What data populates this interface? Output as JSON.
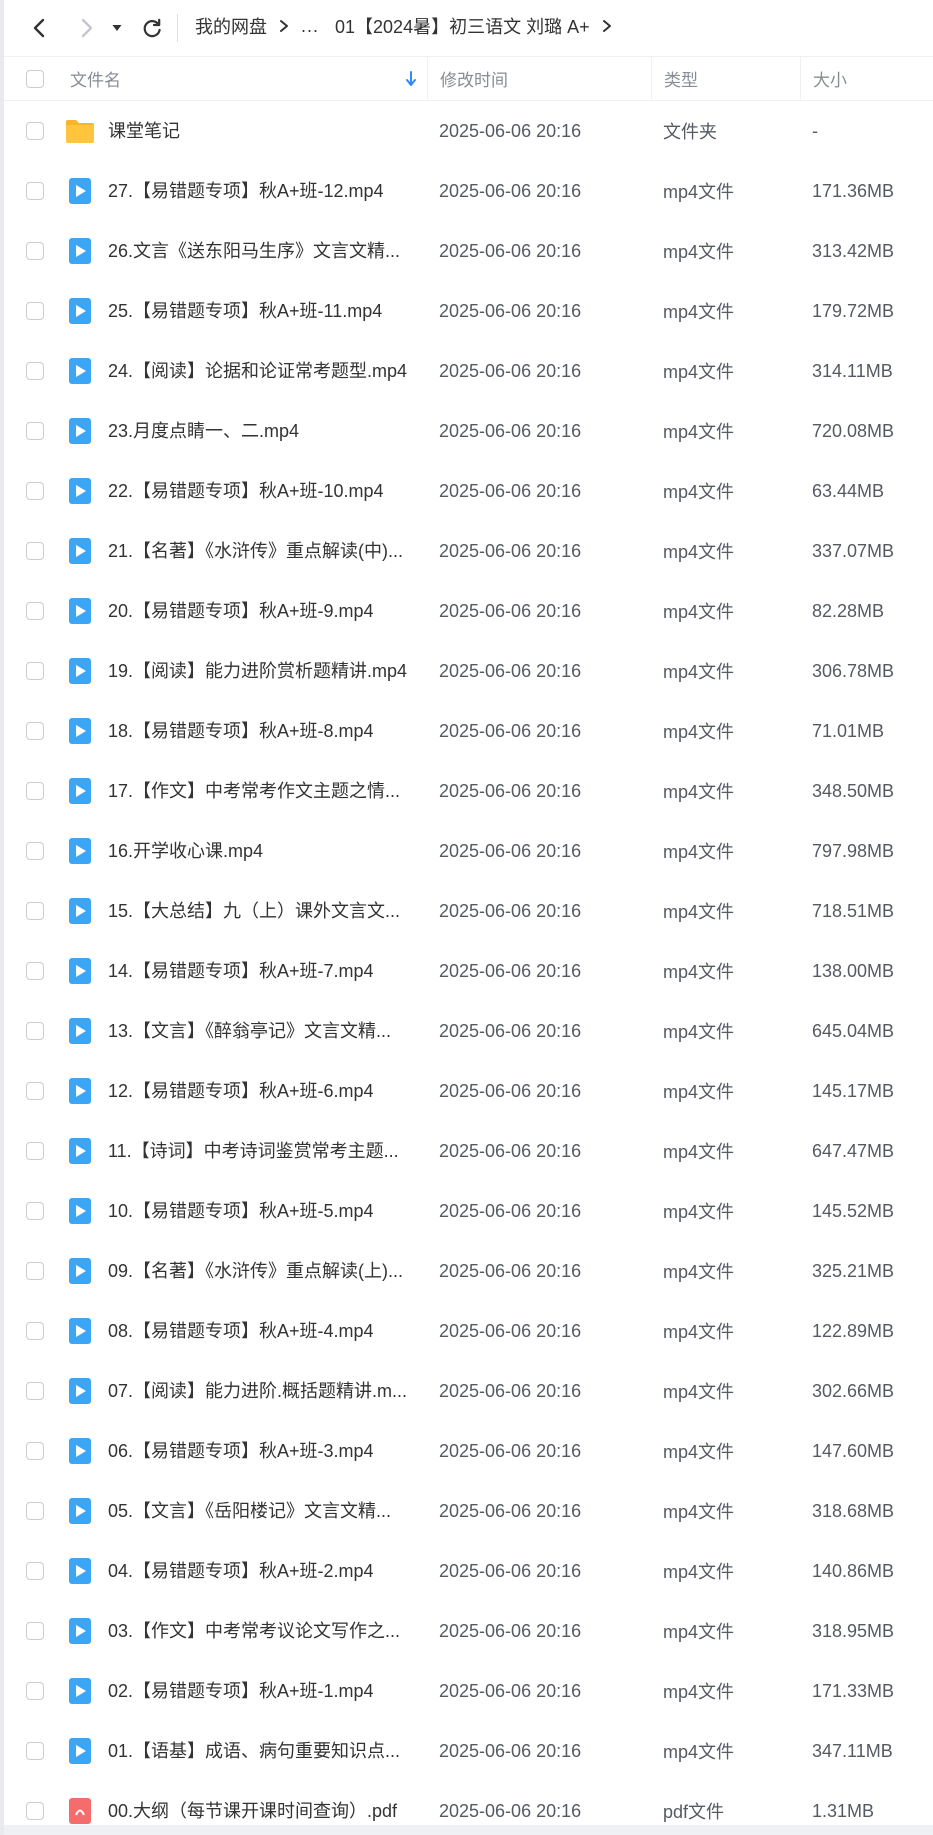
{
  "toolbar": {
    "back_icon": "chevron-left-icon",
    "forward_icon": "chevron-right-icon",
    "dropdown_icon": "caret-down-icon",
    "refresh_icon": "refresh-icon"
  },
  "breadcrumb": {
    "root": "我的网盘",
    "ellipsis": "...",
    "current": "01【2024暑】初三语文 刘璐 A+"
  },
  "header": {
    "name": "文件名",
    "modified": "修改时间",
    "type": "类型",
    "size": "大小"
  },
  "colors": {
    "video_icon": "#3ba6f5",
    "folder_icon": "#ffc53d",
    "pdf_icon": "#f56c6c",
    "sort_arrow": "#2f88ff"
  },
  "files": [
    {
      "icon": "folder-icon",
      "name": "课堂笔记",
      "time": "2025-06-06 20:16",
      "type": "文件夹",
      "size": "-"
    },
    {
      "icon": "video-file-icon",
      "name": "27.【易错题专项】秋A+班-12.mp4",
      "time": "2025-06-06 20:16",
      "type": "mp4文件",
      "size": "171.36MB"
    },
    {
      "icon": "video-file-icon",
      "name": "26.文言《送东阳马生序》文言文精...",
      "time": "2025-06-06 20:16",
      "type": "mp4文件",
      "size": "313.42MB"
    },
    {
      "icon": "video-file-icon",
      "name": "25.【易错题专项】秋A+班-11.mp4",
      "time": "2025-06-06 20:16",
      "type": "mp4文件",
      "size": "179.72MB"
    },
    {
      "icon": "video-file-icon",
      "name": "24.【阅读】论据和论证常考题型.mp4",
      "time": "2025-06-06 20:16",
      "type": "mp4文件",
      "size": "314.11MB"
    },
    {
      "icon": "video-file-icon",
      "name": "23.月度点睛一、二.mp4",
      "time": "2025-06-06 20:16",
      "type": "mp4文件",
      "size": "720.08MB"
    },
    {
      "icon": "video-file-icon",
      "name": "22.【易错题专项】秋A+班-10.mp4",
      "time": "2025-06-06 20:16",
      "type": "mp4文件",
      "size": "63.44MB"
    },
    {
      "icon": "video-file-icon",
      "name": "21.【名著】《水浒传》重点解读(中)...",
      "time": "2025-06-06 20:16",
      "type": "mp4文件",
      "size": "337.07MB"
    },
    {
      "icon": "video-file-icon",
      "name": "20.【易错题专项】秋A+班-9.mp4",
      "time": "2025-06-06 20:16",
      "type": "mp4文件",
      "size": "82.28MB"
    },
    {
      "icon": "video-file-icon",
      "name": "19.【阅读】能力进阶赏析题精讲.mp4",
      "time": "2025-06-06 20:16",
      "type": "mp4文件",
      "size": "306.78MB"
    },
    {
      "icon": "video-file-icon",
      "name": "18.【易错题专项】秋A+班-8.mp4",
      "time": "2025-06-06 20:16",
      "type": "mp4文件",
      "size": "71.01MB"
    },
    {
      "icon": "video-file-icon",
      "name": "17.【作文】中考常考作文主题之情...",
      "time": "2025-06-06 20:16",
      "type": "mp4文件",
      "size": "348.50MB"
    },
    {
      "icon": "video-file-icon",
      "name": "16.开学收心课.mp4",
      "time": "2025-06-06 20:16",
      "type": "mp4文件",
      "size": "797.98MB"
    },
    {
      "icon": "video-file-icon",
      "name": "15.【大总结】九（上）课外文言文...",
      "time": "2025-06-06 20:16",
      "type": "mp4文件",
      "size": "718.51MB"
    },
    {
      "icon": "video-file-icon",
      "name": "14.【易错题专项】秋A+班-7.mp4",
      "time": "2025-06-06 20:16",
      "type": "mp4文件",
      "size": "138.00MB"
    },
    {
      "icon": "video-file-icon",
      "name": "13.【文言】《醉翁亭记》文言文精...",
      "time": "2025-06-06 20:16",
      "type": "mp4文件",
      "size": "645.04MB"
    },
    {
      "icon": "video-file-icon",
      "name": "12.【易错题专项】秋A+班-6.mp4",
      "time": "2025-06-06 20:16",
      "type": "mp4文件",
      "size": "145.17MB"
    },
    {
      "icon": "video-file-icon",
      "name": "11.【诗词】中考诗词鉴赏常考主题...",
      "time": "2025-06-06 20:16",
      "type": "mp4文件",
      "size": "647.47MB"
    },
    {
      "icon": "video-file-icon",
      "name": "10.【易错题专项】秋A+班-5.mp4",
      "time": "2025-06-06 20:16",
      "type": "mp4文件",
      "size": "145.52MB"
    },
    {
      "icon": "video-file-icon",
      "name": "09.【名著】《水浒传》重点解读(上)...",
      "time": "2025-06-06 20:16",
      "type": "mp4文件",
      "size": "325.21MB"
    },
    {
      "icon": "video-file-icon",
      "name": "08.【易错题专项】秋A+班-4.mp4",
      "time": "2025-06-06 20:16",
      "type": "mp4文件",
      "size": "122.89MB"
    },
    {
      "icon": "video-file-icon",
      "name": "07.【阅读】能力进阶.概括题精讲.m...",
      "time": "2025-06-06 20:16",
      "type": "mp4文件",
      "size": "302.66MB"
    },
    {
      "icon": "video-file-icon",
      "name": "06.【易错题专项】秋A+班-3.mp4",
      "time": "2025-06-06 20:16",
      "type": "mp4文件",
      "size": "147.60MB"
    },
    {
      "icon": "video-file-icon",
      "name": "05.【文言】《岳阳楼记》文言文精...",
      "time": "2025-06-06 20:16",
      "type": "mp4文件",
      "size": "318.68MB"
    },
    {
      "icon": "video-file-icon",
      "name": "04.【易错题专项】秋A+班-2.mp4",
      "time": "2025-06-06 20:16",
      "type": "mp4文件",
      "size": "140.86MB"
    },
    {
      "icon": "video-file-icon",
      "name": "03.【作文】中考常考议论文写作之...",
      "time": "2025-06-06 20:16",
      "type": "mp4文件",
      "size": "318.95MB"
    },
    {
      "icon": "video-file-icon",
      "name": "02.【易错题专项】秋A+班-1.mp4",
      "time": "2025-06-06 20:16",
      "type": "mp4文件",
      "size": "171.33MB"
    },
    {
      "icon": "video-file-icon",
      "name": "01.【语基】成语、病句重要知识点...",
      "time": "2025-06-06 20:16",
      "type": "mp4文件",
      "size": "347.11MB"
    },
    {
      "icon": "pdf-file-icon",
      "name": "00.大纲（每节课开课时间查询）.pdf",
      "time": "2025-06-06 20:16",
      "type": "pdf文件",
      "size": "1.31MB"
    }
  ]
}
